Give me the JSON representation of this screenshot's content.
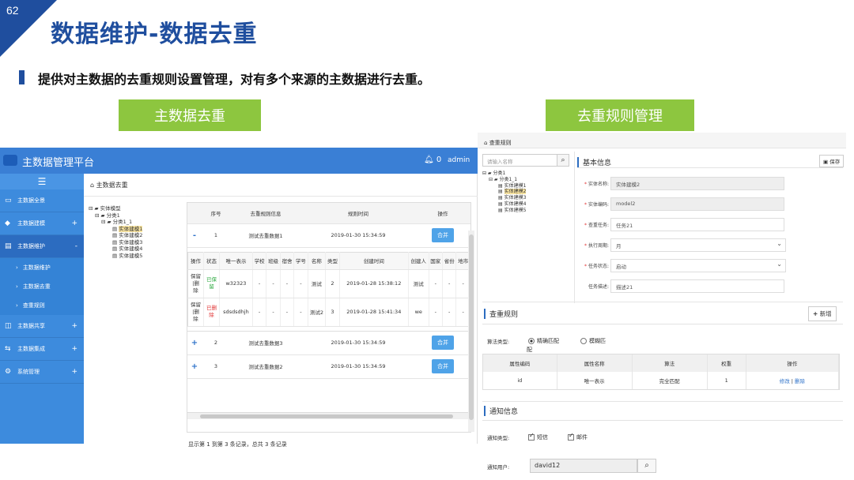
{
  "slide": {
    "page_number": "62",
    "title": "数据维护-数据去重",
    "subtitle": "提供对主数据的去重规则设置管理，对有多个来源的主数据进行去重。",
    "left_label": "主数据去重",
    "right_label": "去重规则管理"
  },
  "left_app": {
    "app_title": "主数据管理平台",
    "notif_count": "0",
    "user": "admin",
    "menu_toggle": "☰",
    "sidebar": [
      {
        "icon": "▭",
        "label": "主数据全景",
        "plus": ""
      },
      {
        "icon": "◆",
        "label": "主数据建模",
        "plus": "+"
      },
      {
        "icon": "▤",
        "label": "主数据维护",
        "plus": "-"
      },
      {
        "icon": "◫",
        "label": "主数据共享",
        "plus": "+"
      },
      {
        "icon": "⇆",
        "label": "主数据集成",
        "plus": "+"
      },
      {
        "icon": "⚙",
        "label": "系统管理",
        "plus": "+"
      }
    ],
    "sidebar_sub": [
      {
        "label": "主数据维护"
      },
      {
        "label": "主数据去重"
      },
      {
        "label": "查重规则"
      }
    ],
    "breadcrumb": "主数据去重",
    "tree": {
      "root": "实体模型",
      "cat1": "分类1",
      "cat11": "分类1_1",
      "items": [
        "实体建模1",
        "实体建模2",
        "实体建模3",
        "实体建模4",
        "实体建模5"
      ]
    },
    "grid_headers": [
      "序号",
      "去重规则信息",
      "规则时间",
      "操作"
    ],
    "rows": [
      {
        "toggle": "-",
        "no": "1",
        "rule": "测试去重数据1",
        "time": "2019-01-30 15:34:59",
        "action": "合并"
      },
      {
        "toggle": "+",
        "no": "2",
        "rule": "测试去重数据3",
        "time": "2019-01-30 15:34:59",
        "action": "合并"
      },
      {
        "toggle": "+",
        "no": "3",
        "rule": "测试去重数据2",
        "time": "2019-01-30 15:34:59",
        "action": "合并"
      }
    ],
    "inner_headers": [
      "操作",
      "状态",
      "唯一表示",
      "学校",
      "班级",
      "宿舍",
      "学号",
      "名称",
      "类型",
      "创建时间",
      "创建人",
      "国家",
      "省份",
      "地市"
    ],
    "inner_rows": [
      {
        "op": "保留|删除",
        "status": "已保留",
        "uid": "w32323",
        "school": "-",
        "cls": "-",
        "dorm": "-",
        "sno": "-",
        "name": "测试",
        "type": "2",
        "ctime": "2019-01-28 15:38:12",
        "creator": "测试",
        "country": "-",
        "prov": "-",
        "city": "-"
      },
      {
        "op": "保留|删除",
        "status": "已删除",
        "uid": "sdsdsdhjh",
        "school": "-",
        "cls": "-",
        "dorm": "-",
        "sno": "-",
        "name": "测试2",
        "type": "3",
        "ctime": "2019-01-28 15:41:34",
        "creator": "we",
        "country": "-",
        "prov": "-",
        "city": "-"
      }
    ],
    "footer": "显示第 1 到第 3 条记录，总共 3 条记录"
  },
  "right_app": {
    "breadcrumb": "查重规则",
    "search_placeholder": "请输入名称",
    "tree": {
      "cat1": "分类1",
      "cat11": "分类1_1",
      "items": [
        "实体建模1",
        "实体建模2",
        "实体建模3",
        "实体建模4",
        "实体建模5"
      ]
    },
    "basic_title": "基本信息",
    "save_label": "保存",
    "fields": [
      {
        "label": "实体名称:",
        "value": "实体建模2",
        "required": true,
        "select": false,
        "disabled": true
      },
      {
        "label": "实体编码:",
        "value": "model2",
        "required": true,
        "select": false,
        "disabled": true
      },
      {
        "label": "查重任务:",
        "value": "任务21",
        "required": true,
        "select": false,
        "disabled": false
      },
      {
        "label": "执行周期:",
        "value": "月",
        "required": true,
        "select": true,
        "disabled": false
      },
      {
        "label": "任务状态:",
        "value": "启动",
        "required": true,
        "select": true,
        "disabled": false
      },
      {
        "label": "任务描述:",
        "value": "描述21",
        "required": false,
        "select": false,
        "disabled": false
      }
    ],
    "rule_title": "查重规则",
    "add_label": "新增",
    "algo_label": "算法类型:",
    "algo_options": [
      "精确匹配",
      "模糊匹"
    ],
    "rule_headers": [
      "属性编码",
      "属性名称",
      "算法",
      "权重",
      "操作"
    ],
    "rule_rows": [
      {
        "code": "id",
        "name": "唯一表示",
        "algo": "完全匹配",
        "weight": "1",
        "edit": "修改",
        "sep": " | ",
        "del": "删除"
      }
    ],
    "notice_title": "通知信息",
    "notice_type_label": "通知类型:",
    "notice_types": [
      "短信",
      "邮件"
    ],
    "notice_user_label": "通知用户:",
    "notice_user_value": "david12"
  }
}
